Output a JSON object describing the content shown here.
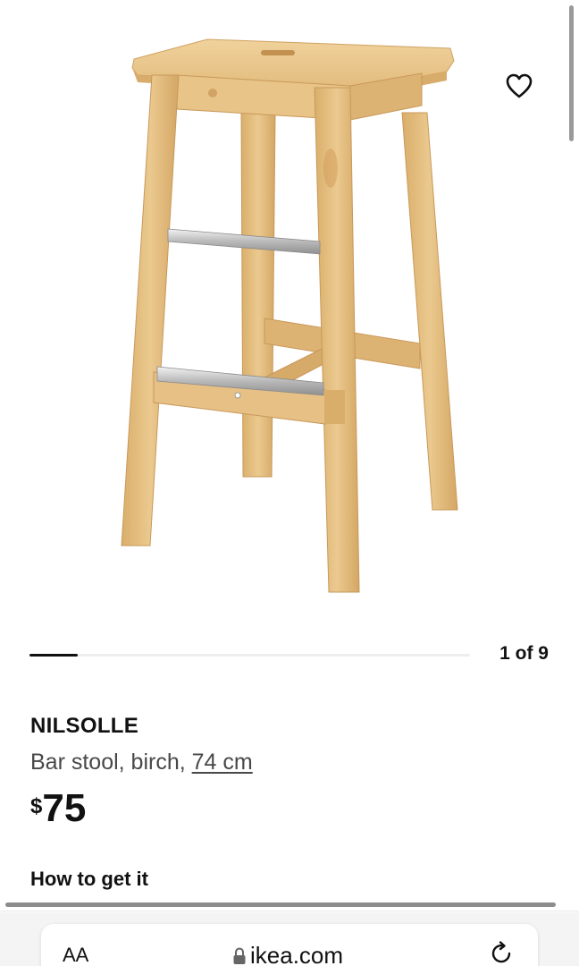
{
  "product": {
    "name": "NILSOLLE",
    "description_prefix": "Bar stool, birch, ",
    "description_link": "74 cm",
    "price_currency": "$",
    "price_amount": "75"
  },
  "carousel": {
    "counter": "1 of 9",
    "progress": 0.11
  },
  "section": {
    "how_to_get": "How to get it"
  },
  "browser": {
    "text_size_label": "AA",
    "url": "ikea.com"
  },
  "icons": {
    "favorite": "heart-icon",
    "lock": "lock-icon",
    "reload": "reload-icon"
  },
  "colors": {
    "text": "#111111",
    "muted_text": "#484848",
    "wood": "#E2BC7E"
  }
}
